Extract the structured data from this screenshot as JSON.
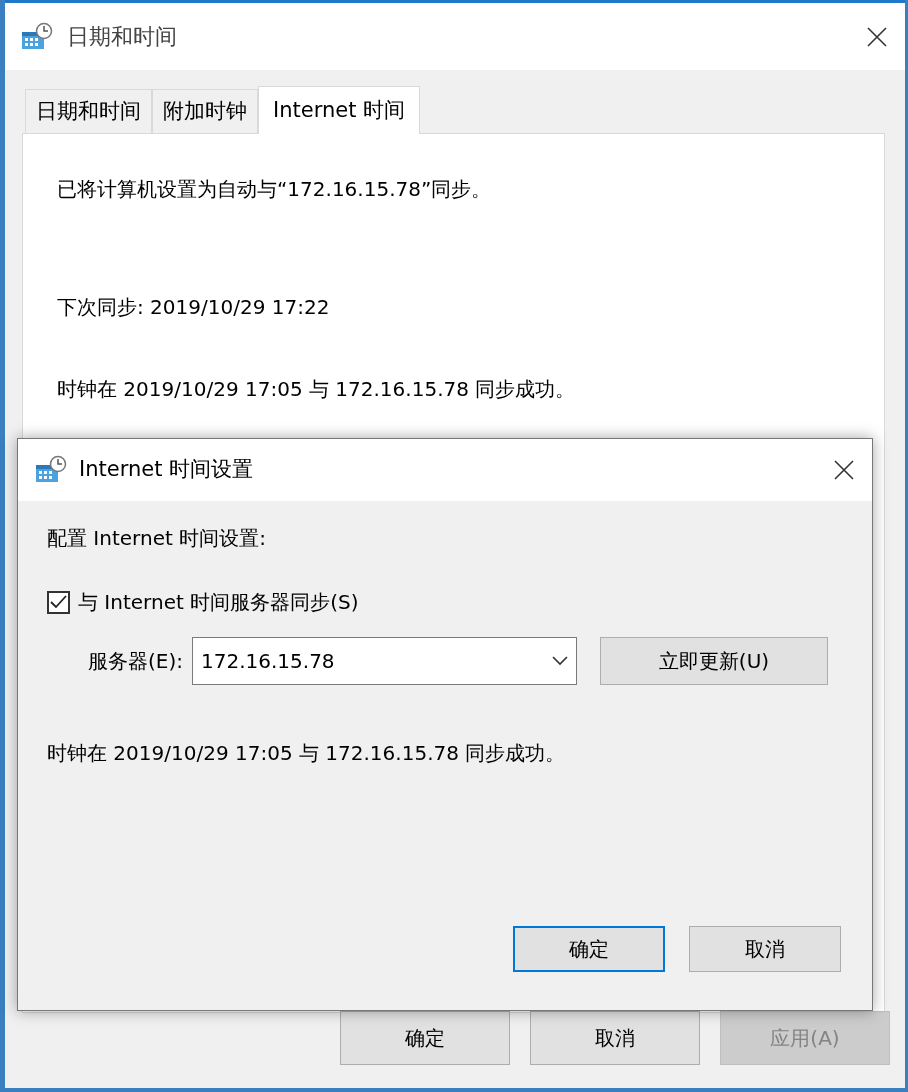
{
  "window": {
    "title": "日期和时间"
  },
  "tabs": [
    {
      "label": "日期和时间",
      "selected": false
    },
    {
      "label": "附加时钟",
      "selected": false
    },
    {
      "label": "Internet 时间",
      "selected": true
    }
  ],
  "panel": {
    "lines": [
      "已将计算机设置为自动与“172.16.15.78”同步。",
      "下次同步: 2019/10/29 17:22",
      "时钟在 2019/10/29 17:05 与 172.16.15.78 同步成功。"
    ]
  },
  "buttons": [
    {
      "label": "确定",
      "disabled": false
    },
    {
      "label": "取消",
      "disabled": false
    },
    {
      "label": "应用(A)",
      "disabled": true
    }
  ],
  "dialog": {
    "title": "Internet 时间设置",
    "heading": "配置 Internet 时间设置:",
    "sync_checkbox": {
      "label": "与 Internet 时间服务器同步(S)",
      "checked": true
    },
    "server": {
      "label": "服务器(E):",
      "value": "172.16.15.78"
    },
    "update_button": "立即更新(U)",
    "status": "时钟在 2019/10/29 17:05 与 172.16.15.78 同步成功。",
    "buttons": [
      {
        "label": "确定",
        "default": true
      },
      {
        "label": "取消",
        "default": false
      }
    ]
  }
}
